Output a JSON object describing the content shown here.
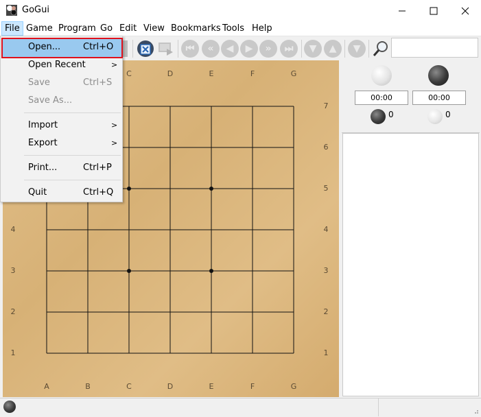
{
  "window": {
    "title": "GoGui"
  },
  "menubar": [
    "File",
    "Game",
    "Program",
    "Go",
    "Edit",
    "View",
    "Bookmarks",
    "Tools",
    "Help"
  ],
  "file_menu": {
    "open": {
      "label": "Open...",
      "shortcut": "Ctrl+O"
    },
    "open_recent": {
      "label": "Open Recent"
    },
    "save": {
      "label": "Save",
      "shortcut": "Ctrl+S"
    },
    "save_as": {
      "label": "Save As..."
    },
    "import": {
      "label": "Import"
    },
    "export": {
      "label": "Export"
    },
    "print": {
      "label": "Print...",
      "shortcut": "Ctrl+P"
    },
    "quit": {
      "label": "Quit",
      "shortcut": "Ctrl+Q"
    },
    "submenu_arrow": ">"
  },
  "board": {
    "size": 7,
    "columns": [
      "A",
      "B",
      "C",
      "D",
      "E",
      "F",
      "G"
    ],
    "rows": [
      "7",
      "6",
      "5",
      "4",
      "3",
      "2",
      "1"
    ],
    "hoshi": [
      "C5",
      "E5",
      "C3",
      "E3"
    ]
  },
  "clocks": {
    "white_time": "00:00",
    "black_time": "00:00",
    "black_captures": "0",
    "white_captures": "0"
  },
  "search": {
    "value": ""
  },
  "colors": {
    "board": "#d9b47a",
    "highlight": "#99c9ef",
    "annotation": "#e0101b"
  }
}
